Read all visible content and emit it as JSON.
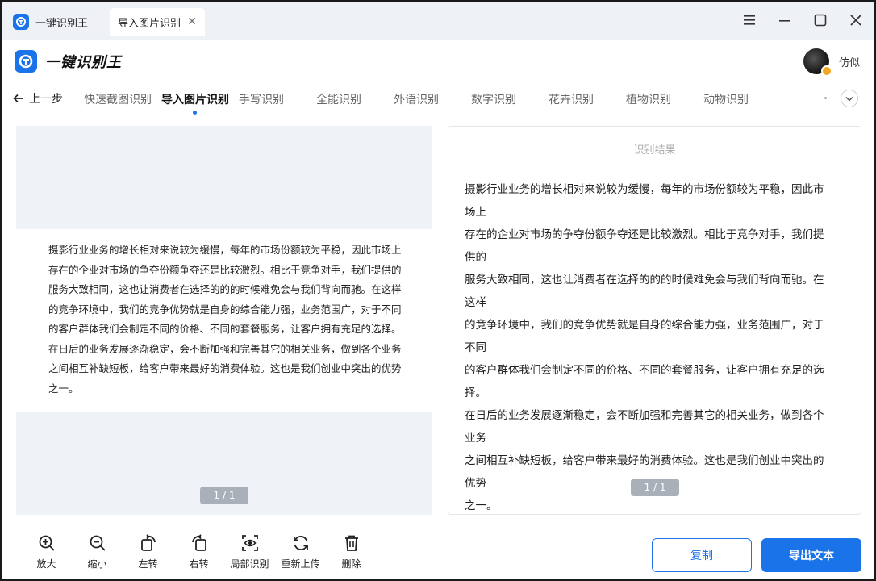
{
  "titlebar": {
    "app_tab_label": "一键识别王",
    "active_tab_label": "导入图片识别",
    "close_glyph": "✕"
  },
  "header": {
    "brand": "一键识别王",
    "user_name": "仿似"
  },
  "nav": {
    "back_label": "上一步",
    "items": [
      {
        "label": "快速截图识别"
      },
      {
        "label": "导入图片识别"
      },
      {
        "label": "手写识别"
      },
      {
        "label": "全能识别"
      },
      {
        "label": "外语识别"
      },
      {
        "label": "数字识别"
      },
      {
        "label": "花卉识别"
      },
      {
        "label": "植物识别"
      },
      {
        "label": "动物识别"
      }
    ]
  },
  "source": {
    "lines": [
      "摄影行业业务的增长相对来说较为缓慢，每年的市场份额较为平稳，因此市场上",
      "存在的企业对市场的争夺份额争夺还是比较激烈。相比于竞争对手，我们提供的",
      "服务大致相同，这也让消费者在选择的的的时候难免会与我们背向而驰。在这样",
      "的竞争环境中，我们的竞争优势就是自身的综合能力强，业务范围广，对于不同",
      "的客户群体我们会制定不同的价格、不同的套餐服务，让客户拥有充足的选择。",
      "在日后的业务发展逐渐稳定，会不断加强和完善其它的相关业务，做到各个业务",
      "之间相互补缺短板，给客户带来最好的消费体验。这也是我们创业中突出的优势",
      "之一。"
    ],
    "pager": "1 / 1"
  },
  "result": {
    "title": "识别结果",
    "lines": [
      "摄影行业业务的增长相对来说较为缓慢，每年的市场份额较为平稳，因此市",
      "场上",
      "存在的企业对市场的争夺份额争夺还是比较激烈。相比于竞争对手，我们提",
      "供的",
      "服务大致相同，这也让消费者在选择的的的时候难免会与我们背向而驰。在",
      "这样",
      "的竞争环境中，我们的竞争优势就是自身的综合能力强，业务范围广，对于",
      "不同",
      "的客户群体我们会制定不同的价格、不同的套餐服务，让客户拥有充足的选",
      "择。",
      "在日后的业务发展逐渐稳定，会不断加强和完善其它的相关业务，做到各个",
      "业务",
      "之间相互补缺短板，给客户带来最好的消费体验。这也是我们创业中突出的",
      "优势",
      "之一。"
    ],
    "pager": "1 / 1"
  },
  "toolbar": {
    "zoom_in": "放大",
    "zoom_out": "缩小",
    "rotate_left": "左转",
    "rotate_right": "右转",
    "partial": "局部识别",
    "reupload": "重新上传",
    "delete": "删除",
    "copy": "复制",
    "export": "导出文本"
  },
  "colors": {
    "accent": "#1a73e8",
    "placeholder_gray": "#eff2f6",
    "pager_gray": "#aab0ba"
  },
  "icons": [
    "app-logo-icon",
    "close-icon",
    "menu-icon",
    "minimize-icon",
    "maximize-icon",
    "window-close-icon",
    "back-arrow-icon",
    "chevron-down-icon",
    "zoom-in-icon",
    "zoom-out-icon",
    "rotate-left-icon",
    "rotate-right-icon",
    "eye-scan-icon",
    "refresh-icon",
    "trash-icon"
  ]
}
